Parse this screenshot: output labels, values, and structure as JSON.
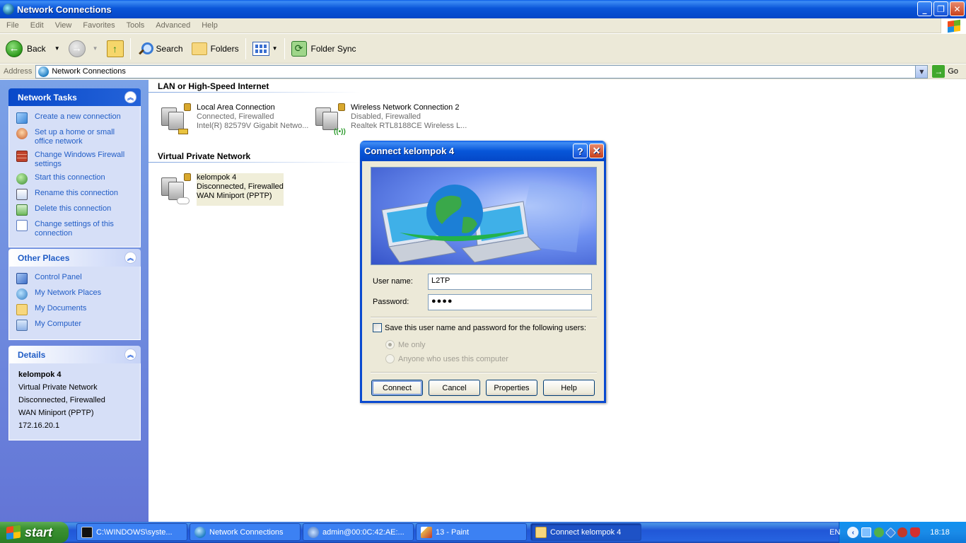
{
  "window": {
    "title": "Network Connections"
  },
  "menu": [
    "File",
    "Edit",
    "View",
    "Favorites",
    "Tools",
    "Advanced",
    "Help"
  ],
  "toolbar": {
    "back": "Back",
    "search": "Search",
    "folders": "Folders",
    "folder_sync": "Folder Sync"
  },
  "address": {
    "label": "Address",
    "value": "Network Connections",
    "go": "Go"
  },
  "network_tasks": {
    "title": "Network Tasks",
    "items": [
      "Create a new connection",
      "Set up a home or small office network",
      "Change Windows Firewall settings",
      "Start this connection",
      "Rename this connection",
      "Delete this connection",
      "Change settings of this connection"
    ]
  },
  "other_places": {
    "title": "Other Places",
    "items": [
      "Control Panel",
      "My Network Places",
      "My Documents",
      "My Computer"
    ]
  },
  "details": {
    "title": "Details",
    "name": "kelompok 4",
    "type": "Virtual Private Network",
    "status": "Disconnected, Firewalled",
    "device": "WAN Miniport (PPTP)",
    "ip": "172.16.20.1"
  },
  "groups": {
    "lan": "LAN or High-Speed Internet",
    "vpn": "Virtual Private Network"
  },
  "connections": {
    "lan": {
      "name": "Local Area Connection",
      "status": "Connected, Firewalled",
      "device": "Intel(R) 82579V Gigabit Netwo..."
    },
    "wifi": {
      "name": "Wireless Network Connection 2",
      "status": "Disabled, Firewalled",
      "device": "Realtek RTL8188CE Wireless L..."
    },
    "vpn": {
      "name": "kelompok 4",
      "status": "Disconnected, Firewalled",
      "device": "WAN Miniport (PPTP)"
    }
  },
  "dialog": {
    "title": "Connect kelompok 4",
    "username_label": "User name:",
    "username_value": "L2TP",
    "password_label": "Password:",
    "password_value": "●●●●",
    "save_label": "Save this user name and password for the following users:",
    "me_only": "Me only",
    "anyone": "Anyone who uses this computer",
    "buttons": {
      "connect": "Connect",
      "cancel": "Cancel",
      "properties": "Properties",
      "help": "Help"
    }
  },
  "taskbar": {
    "start": "start",
    "tasks": [
      "C:\\WINDOWS\\syste...",
      "Network Connections",
      "admin@00:0C:42:AE:...",
      "13 - Paint",
      "Connect kelompok 4"
    ],
    "lang": "EN",
    "clock": "18:18"
  }
}
